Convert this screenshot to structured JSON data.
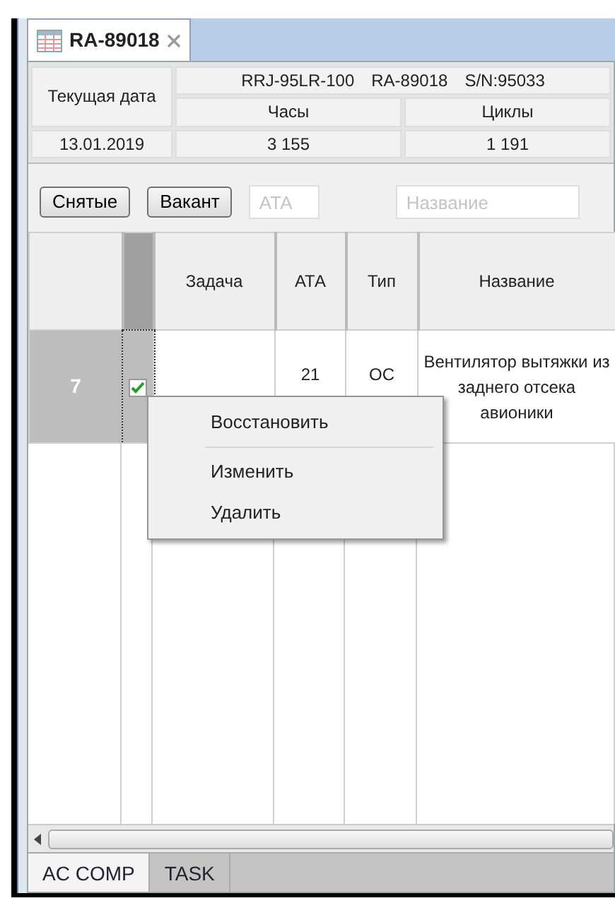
{
  "editor_tab": {
    "title": "RA-89018",
    "selected": true
  },
  "summary": {
    "date_label": "Текущая дата",
    "aircraft": [
      "RRJ-95LR-100",
      "RA-89018",
      "S/N:95033"
    ],
    "hours_label": "Часы",
    "cycles_label": "Циклы",
    "date": "13.01.2019",
    "hours": "3 155",
    "cycles": "1 191"
  },
  "toolbar": {
    "buttons": [
      "Снятые",
      "Вакант"
    ],
    "fields": [
      {
        "placeholder": "ATA"
      },
      {
        "placeholder": "Название"
      }
    ]
  },
  "table": {
    "columns": [
      "Задача",
      "АТА",
      "Тип",
      "Название"
    ],
    "rows": [
      {
        "number": "7",
        "selected": true,
        "checked": true,
        "ata": "21",
        "type": "ОС",
        "name": "Вентилятор вытяжки из заднего отсека авионики"
      }
    ]
  },
  "context_menu": {
    "groups": [
      [
        "Восстановить"
      ],
      [
        "Изменить",
        "Удалить"
      ]
    ]
  },
  "bottom_tabs": [
    {
      "label": "AC COMP",
      "selected": true
    },
    {
      "label": "TASK",
      "selected": false
    }
  ]
}
